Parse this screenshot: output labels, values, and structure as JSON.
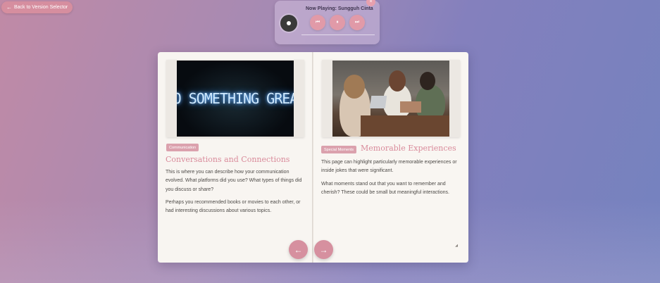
{
  "back_button": {
    "label": "Back to Version Selector",
    "arrow": "←"
  },
  "player": {
    "now_playing": "Now Playing: Sungguh Cinta",
    "controls": {
      "prev": "⏮",
      "pause": "⏸",
      "next": "⏭",
      "close": "×"
    }
  },
  "left_page": {
    "image_text": "DO SOMETHING GREAT",
    "badge": "Communication",
    "title": "Conversations and Connections",
    "paragraphs": [
      "This is where you can describe how your communication evolved. What platforms did you use? What types of things did you discuss or share?",
      "Perhaps you recommended books or movies to each other, or had interesting discussions about various topics."
    ]
  },
  "right_page": {
    "badge": "Special Moments",
    "title": "Memorable Experiences",
    "paragraphs": [
      "This page can highlight particularly memorable experiences or inside jokes that were significant.",
      "What moments stand out that you want to remember and cherish? These could be small but meaningful interactions."
    ]
  },
  "navigation": {
    "prev": "←",
    "next": "→"
  },
  "colors": {
    "accent": "#d6909f",
    "title": "#d98a9a",
    "page": "#f8f5f1"
  }
}
